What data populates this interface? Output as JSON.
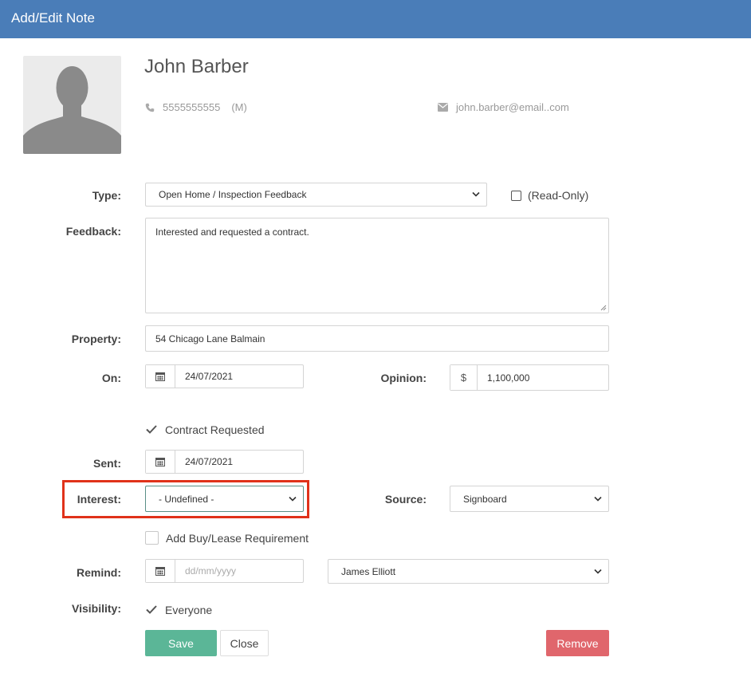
{
  "header": {
    "title": "Add/Edit Note"
  },
  "contact": {
    "name": "John Barber",
    "phone": "5555555555",
    "phone_type": "(M)",
    "email": "john.barber@email..com"
  },
  "form": {
    "type": {
      "label": "Type:",
      "value": "Open Home / Inspection Feedback"
    },
    "read_only": {
      "label": "(Read-Only)",
      "checked": false
    },
    "feedback": {
      "label": "Feedback:",
      "value": "Interested and requested a contract."
    },
    "property": {
      "label": "Property:",
      "value": "54 Chicago Lane Balmain"
    },
    "on": {
      "label": "On:",
      "value": "24/07/2021"
    },
    "opinion": {
      "label": "Opinion:",
      "currency": "$",
      "value": "1,100,000"
    },
    "contract_requested": {
      "label": "Contract Requested",
      "checked": true
    },
    "sent": {
      "label": "Sent:",
      "value": "24/07/2021"
    },
    "interest": {
      "label": "Interest:",
      "value": "- Undefined -"
    },
    "source": {
      "label": "Source:",
      "value": "Signboard"
    },
    "buy_lease": {
      "label": "Add Buy/Lease Requirement",
      "checked": false
    },
    "remind": {
      "label": "Remind:",
      "placeholder": "dd/mm/yyyy",
      "agent": "James Elliott"
    },
    "visibility": {
      "label": "Visibility:",
      "option": "Everyone",
      "checked": true
    }
  },
  "buttons": {
    "save": "Save",
    "close": "Close",
    "remove": "Remove"
  },
  "colors": {
    "header": "#4a7db8",
    "save": "#5bb697",
    "remove": "#e0666c",
    "highlight": "#e0321a"
  }
}
